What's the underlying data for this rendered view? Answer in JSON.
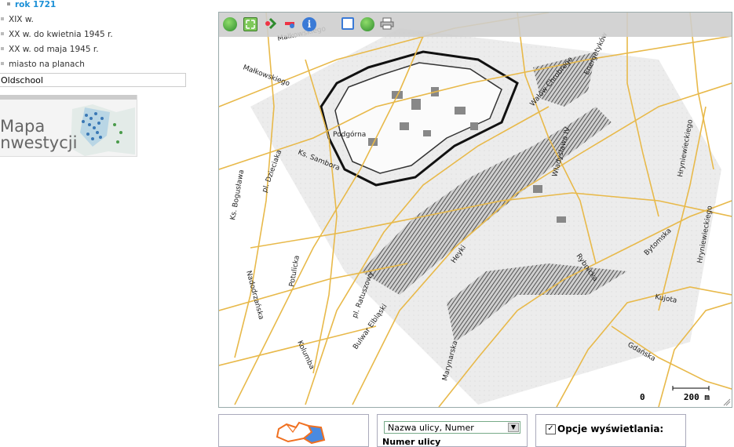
{
  "sidebar": {
    "items": [
      {
        "label": "rok 1721",
        "active": true
      },
      {
        "label": "XIX w."
      },
      {
        "label": "XX w. do kwietnia 1945 r."
      },
      {
        "label": "XX w. od maja 1945 r."
      },
      {
        "label": "miasto na planach"
      }
    ],
    "layer_input_value": "Oldschool",
    "promo": {
      "line1": "Mapa",
      "line2": "Inwestycji"
    }
  },
  "map": {
    "toolbar": [
      "globe-icon",
      "fullscreen-icon",
      "add-point-icon",
      "remove-point-icon",
      "info-icon",
      "window-icon",
      "layers-icon",
      "print-icon"
    ],
    "street_labels": [
      "Małkowskiego",
      "Podgórna",
      "Ks. Sambora",
      "pl. Dzieciaka",
      "Ks. Bogusława",
      "Potulicka",
      "Nadodrzańska",
      "Kolumba",
      "pl. Ratuszowy",
      "Bulwar Elbląski",
      "Wałów Chrobrego",
      "Bytomska",
      "Gdańska",
      "Kujota",
      "Rybnicka",
      "Władysława IV",
      "Heyki",
      "Marynarska",
      "Hryniewieckiego",
      "Energetyków"
    ],
    "scale": {
      "start": "0",
      "end": "200 m"
    }
  },
  "bottom": {
    "search_select_value": "Nazwa ulicy, Numer",
    "search_label_partial": "Numer ulicy",
    "options_label": "Opcje wyświetlania:",
    "options_checked": true
  },
  "colors": {
    "accent": "#1a8fd6",
    "road": "#e8b94a",
    "water_hatch": "#555555"
  }
}
